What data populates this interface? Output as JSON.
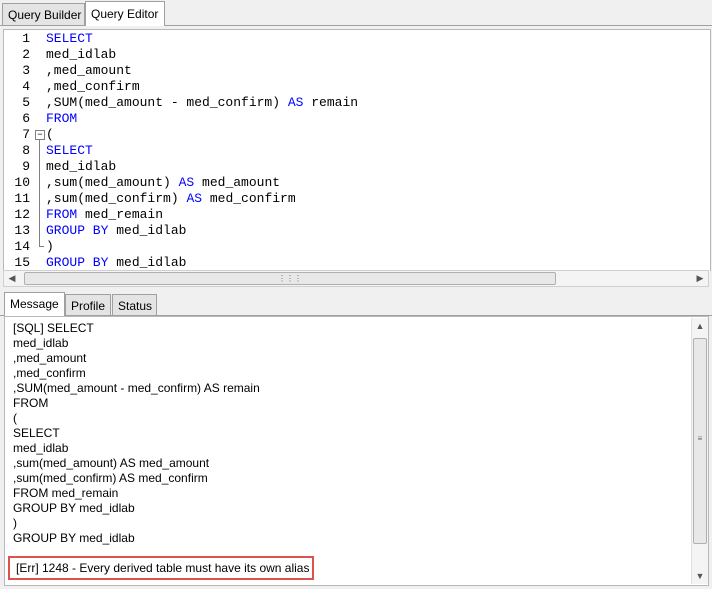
{
  "top_tabs": [
    {
      "label": "Query Builder",
      "active": false
    },
    {
      "label": "Query Editor",
      "active": true
    }
  ],
  "editor": {
    "lines": [
      {
        "num": "1",
        "parts": [
          {
            "text": "SELECT",
            "kw": true
          }
        ]
      },
      {
        "num": "2",
        "parts": [
          {
            "text": "med_idlab",
            "kw": false
          }
        ]
      },
      {
        "num": "3",
        "parts": [
          {
            "text": ",med_amount",
            "kw": false
          }
        ]
      },
      {
        "num": "4",
        "parts": [
          {
            "text": ",med_confirm",
            "kw": false
          }
        ]
      },
      {
        "num": "5",
        "parts": [
          {
            "text": ",SUM(med_amount - med_confirm) ",
            "kw": false
          },
          {
            "text": "AS",
            "kw": true
          },
          {
            "text": " remain",
            "kw": false
          }
        ]
      },
      {
        "num": "6",
        "parts": [
          {
            "text": "FROM",
            "kw": true
          }
        ]
      },
      {
        "num": "7",
        "parts": [
          {
            "text": "(",
            "kw": false
          }
        ],
        "fold": "start"
      },
      {
        "num": "8",
        "parts": [
          {
            "text": "SELECT",
            "kw": true
          }
        ]
      },
      {
        "num": "9",
        "parts": [
          {
            "text": "med_idlab",
            "kw": false
          }
        ]
      },
      {
        "num": "10",
        "parts": [
          {
            "text": ",sum(med_amount) ",
            "kw": false
          },
          {
            "text": "AS",
            "kw": true
          },
          {
            "text": " med_amount",
            "kw": false
          }
        ]
      },
      {
        "num": "11",
        "parts": [
          {
            "text": ",sum(med_confirm) ",
            "kw": false
          },
          {
            "text": "AS",
            "kw": true
          },
          {
            "text": " med_confirm",
            "kw": false
          }
        ]
      },
      {
        "num": "12",
        "parts": [
          {
            "text": "FROM",
            "kw": true
          },
          {
            "text": " med_remain",
            "kw": false
          }
        ]
      },
      {
        "num": "13",
        "parts": [
          {
            "text": "GROUP BY",
            "kw": true
          },
          {
            "text": " med_idlab",
            "kw": false
          }
        ]
      },
      {
        "num": "14",
        "parts": [
          {
            "text": ")",
            "kw": false
          }
        ],
        "fold": "end"
      },
      {
        "num": "15",
        "parts": [
          {
            "text": "GROUP BY",
            "kw": true
          },
          {
            "text": " med_idlab",
            "kw": false
          }
        ]
      }
    ]
  },
  "icons": {
    "scroll_left": "arrow-left-icon",
    "scroll_right": "arrow-right-icon",
    "scroll_up": "arrow-up-icon",
    "scroll_down": "arrow-down-icon",
    "grip": "grip-icon",
    "fold": "fold-minus-icon"
  },
  "bottom_tabs": [
    {
      "label": "Message",
      "active": true
    },
    {
      "label": "Profile",
      "active": false
    },
    {
      "label": "Status",
      "active": false
    }
  ],
  "message": {
    "lines": [
      "[SQL] SELECT",
      "med_idlab",
      ",med_amount",
      ",med_confirm",
      ",SUM(med_amount - med_confirm) AS remain",
      "FROM",
      "(",
      "SELECT",
      "med_idlab",
      ",sum(med_amount) AS med_amount",
      ",sum(med_confirm) AS med_confirm",
      "FROM med_remain",
      "GROUP BY med_idlab",
      ")",
      "GROUP BY med_idlab"
    ],
    "error": "[Err] 1248 - Every derived table must have its own alias"
  },
  "colors": {
    "keyword": "#0000ff",
    "error_highlight": "#d9534f"
  }
}
